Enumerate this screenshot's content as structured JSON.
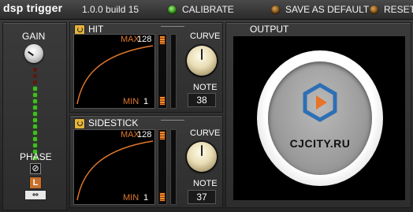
{
  "app": {
    "brand": "dsp trigger",
    "version": "1.0.0 build 15"
  },
  "header": {
    "calibrate": "CALIBRATE",
    "save_default": "SAVE AS DEFAULT",
    "reset": "RESET"
  },
  "gain": {
    "label": "GAIN",
    "meter_leds": [
      "off",
      "off",
      "off",
      "green",
      "green",
      "green",
      "green",
      "green",
      "green",
      "green",
      "green",
      "green",
      "green",
      "green",
      "green"
    ],
    "phase_label": "PHASE",
    "phase_symbol": "⊘",
    "channel": "L",
    "arrows": "⇔"
  },
  "pads": [
    {
      "name": "HIT",
      "max_label": "MAX",
      "max": "128",
      "min_label": "MIN",
      "min": "1",
      "curve_label": "CURVE",
      "note_label": "NOTE",
      "note": "38"
    },
    {
      "name": "SIDESTICK",
      "max_label": "MAX",
      "max": "128",
      "min_label": "MIN",
      "min": "1",
      "curve_label": "CURVE",
      "note_label": "NOTE",
      "note": "37"
    }
  ],
  "output": {
    "title": "OUTPUT",
    "logo_text": "CJCITY.RU"
  },
  "colors": {
    "accent": "#e0782b",
    "led_green": "#3fbf1f",
    "led_amber": "#a8661d"
  }
}
